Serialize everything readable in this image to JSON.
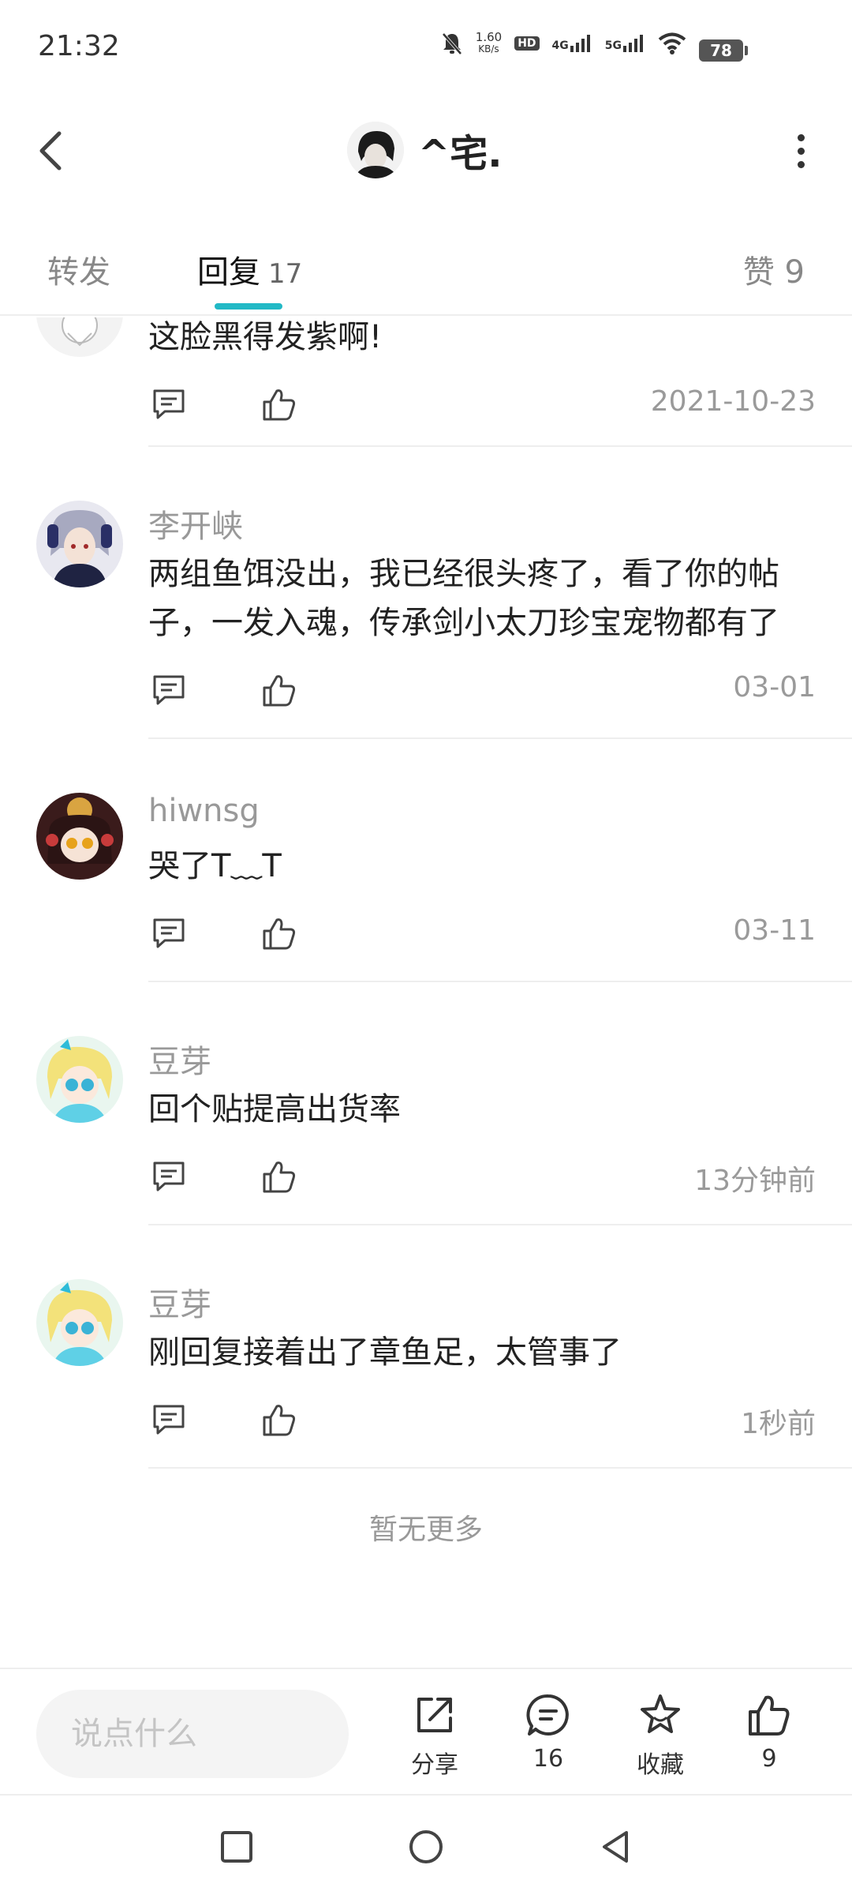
{
  "status_bar": {
    "time": "21:32",
    "net_speed_value": "1.60",
    "net_speed_unit": "KB/s",
    "hd_label": "HD",
    "sim1_label": "4G",
    "sim2_label": "5G",
    "battery": "78"
  },
  "header": {
    "username": "^宅."
  },
  "tabs": {
    "forward_label": "转发",
    "reply_label": "回复",
    "reply_count": "17",
    "like_label": "赞 9"
  },
  "comments": [
    {
      "name": "",
      "text": "这脸黑得发紫啊!",
      "time": "2021-10-23"
    },
    {
      "name": "李开峡",
      "text": "两组鱼饵没出，我已经很头疼了，看了你的帖子，一发入魂，传承剑小太刀珍宝宠物都有了",
      "time": "03-01"
    },
    {
      "name": "hiwnsg",
      "text": "哭了T﹏T",
      "time": "03-11"
    },
    {
      "name": "豆芽",
      "text": "回个贴提高出货率",
      "time": "13分钟前"
    },
    {
      "name": "豆芽",
      "text": "刚回复接着出了章鱼足，太管事了",
      "time": "1秒前"
    }
  ],
  "no_more_text": "暂无更多",
  "bottom_bar": {
    "input_placeholder": "说点什么",
    "share_label": "分享",
    "comment_count": "16",
    "favorite_label": "收藏",
    "like_count": "9"
  },
  "colors": {
    "accent": "#22b9c6",
    "muted_text": "#999999",
    "primary_text": "#222222"
  }
}
